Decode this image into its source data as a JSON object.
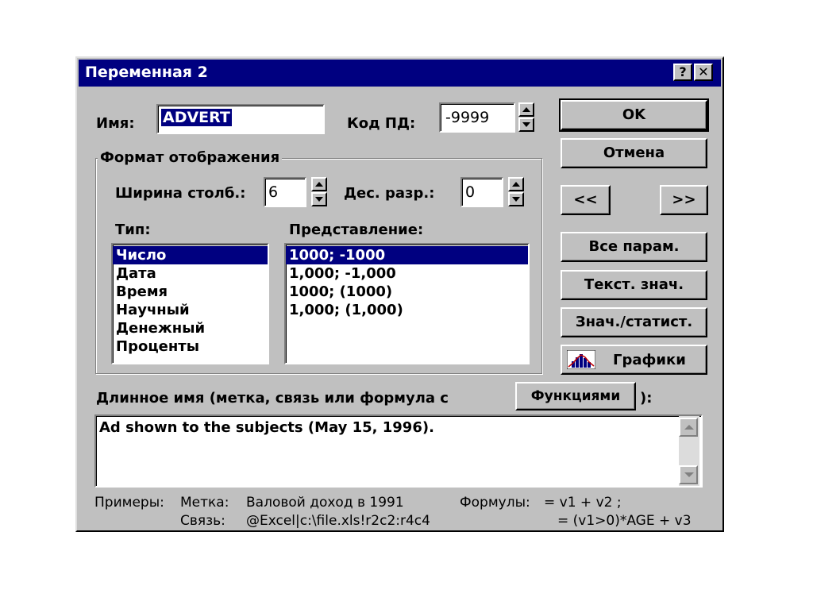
{
  "window": {
    "title": "Переменная 2",
    "help_label": "?",
    "close_label": "✕"
  },
  "name_field": {
    "label": "Имя:",
    "value": "ADVERT"
  },
  "missing_code": {
    "label": "Код ПД:",
    "value": "-9999"
  },
  "format_group": {
    "legend": "Формат отображения",
    "width_label": "Ширина столб.:",
    "width_value": "6",
    "decimals_label": "Дес. разр.:",
    "decimals_value": "0"
  },
  "type_list": {
    "label": "Тип:",
    "items": [
      "Число",
      "Дата",
      "Время",
      "Научный",
      "Денежный",
      "Проценты"
    ],
    "selected_index": 0
  },
  "representation_list": {
    "label": "Представление:",
    "items": [
      "1000; -1000",
      "1,000; -1,000",
      "1000; (1000)",
      "1,000; (1,000)"
    ],
    "selected_index": 0
  },
  "buttons": {
    "ok": "OK",
    "cancel": "Отмена",
    "prev": "<<",
    "next": ">>",
    "all_params": "Все парам.",
    "text_values": "Текст. знач.",
    "values_stats": "Знач./статист.",
    "graphs": "Графики",
    "functions": "Функциями"
  },
  "long_name": {
    "label_prefix": "Длинное имя (метка, связь или формула с",
    "label_suffix": "):",
    "value": "Ad shown to the subjects (May 15, 1996)."
  },
  "examples": {
    "title": "Примеры:",
    "label_key": "Метка:",
    "label_value": "Валовой доход в 1991",
    "link_key": "Связь:",
    "link_value": "@Excel|c:\\file.xls!r2c2:r4c4",
    "formula_key": "Формулы:",
    "formula_value_1": "= v1 + v2 ;",
    "formula_value_2": "= (v1>0)*AGE + v3"
  },
  "colors": {
    "face": "#c0c0c0",
    "title_bar": "#000080",
    "selection": "#000080"
  }
}
